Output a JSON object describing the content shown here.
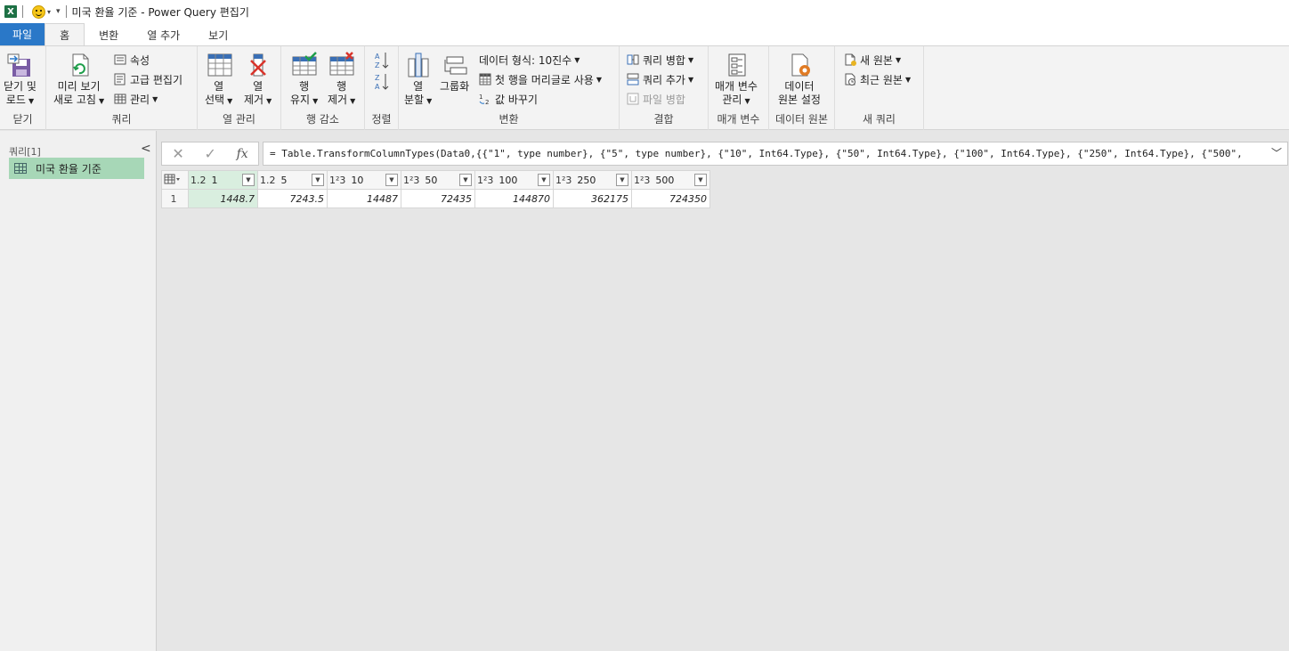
{
  "title": "미국 환율 기준 - Power Query 편집기",
  "tabs": [
    "파일",
    "홈",
    "변환",
    "열 추가",
    "보기"
  ],
  "ribbon": {
    "close": {
      "label1": "닫기 및",
      "label2": "로드",
      "group": "닫기"
    },
    "query": {
      "refresh1": "미리 보기",
      "refresh2": "새로 고침",
      "properties": "속성",
      "advanced_editor": "고급 편집기",
      "manage": "관리",
      "group": "쿼리"
    },
    "columns": {
      "choose1": "열",
      "choose2": "선택",
      "remove1": "열",
      "remove2": "제거",
      "group": "열 관리"
    },
    "rows": {
      "keep1": "행",
      "keep2": "유지",
      "remove1": "행",
      "remove2": "제거",
      "group": "행 감소"
    },
    "sort": {
      "group": "정렬"
    },
    "transform": {
      "split1": "열",
      "split2": "분할",
      "groupby": "그룹화",
      "datatype": "데이터 형식: 10진수",
      "first_row": "첫 행을 머리글로 사용",
      "replace": "값 바꾸기",
      "group": "변환"
    },
    "combine": {
      "merge": "쿼리 병합",
      "append": "쿼리 추가",
      "combine_files": "파일 병합",
      "group": "결합"
    },
    "params": {
      "manage1": "매개 변수",
      "manage2": "관리",
      "group": "매개 변수"
    },
    "datasource": {
      "settings1": "데이터",
      "settings2": "원본 설정",
      "group": "데이터 원본"
    },
    "newquery": {
      "new_source": "새 원본",
      "recent": "최근 원본",
      "group": "새 쿼리"
    }
  },
  "queries_pane": {
    "header": "쿼리[1]",
    "items": [
      "미국 환율 기준"
    ]
  },
  "formula": "= Table.TransformColumnTypes(Data0,{{\"1\", type number}, {\"5\", type number}, {\"10\", Int64.Type}, {\"50\", Int64.Type}, {\"100\", Int64.Type}, {\"250\", Int64.Type}, {\"500\",",
  "table": {
    "columns": [
      {
        "type": "1.2",
        "name": "1"
      },
      {
        "type": "1.2",
        "name": "5"
      },
      {
        "type": "1²3",
        "name": "10"
      },
      {
        "type": "1²3",
        "name": "50"
      },
      {
        "type": "1²3",
        "name": "100"
      },
      {
        "type": "1²3",
        "name": "250"
      },
      {
        "type": "1²3",
        "name": "500"
      }
    ],
    "rows": [
      {
        "num": "1",
        "cells": [
          "1448.7",
          "7243.5",
          "14487",
          "72435",
          "144870",
          "362175",
          "724350"
        ]
      }
    ]
  },
  "colors": {
    "file_tab": "#2a78c8",
    "selected": "#a7d7b7",
    "excel": "#1e7145"
  }
}
